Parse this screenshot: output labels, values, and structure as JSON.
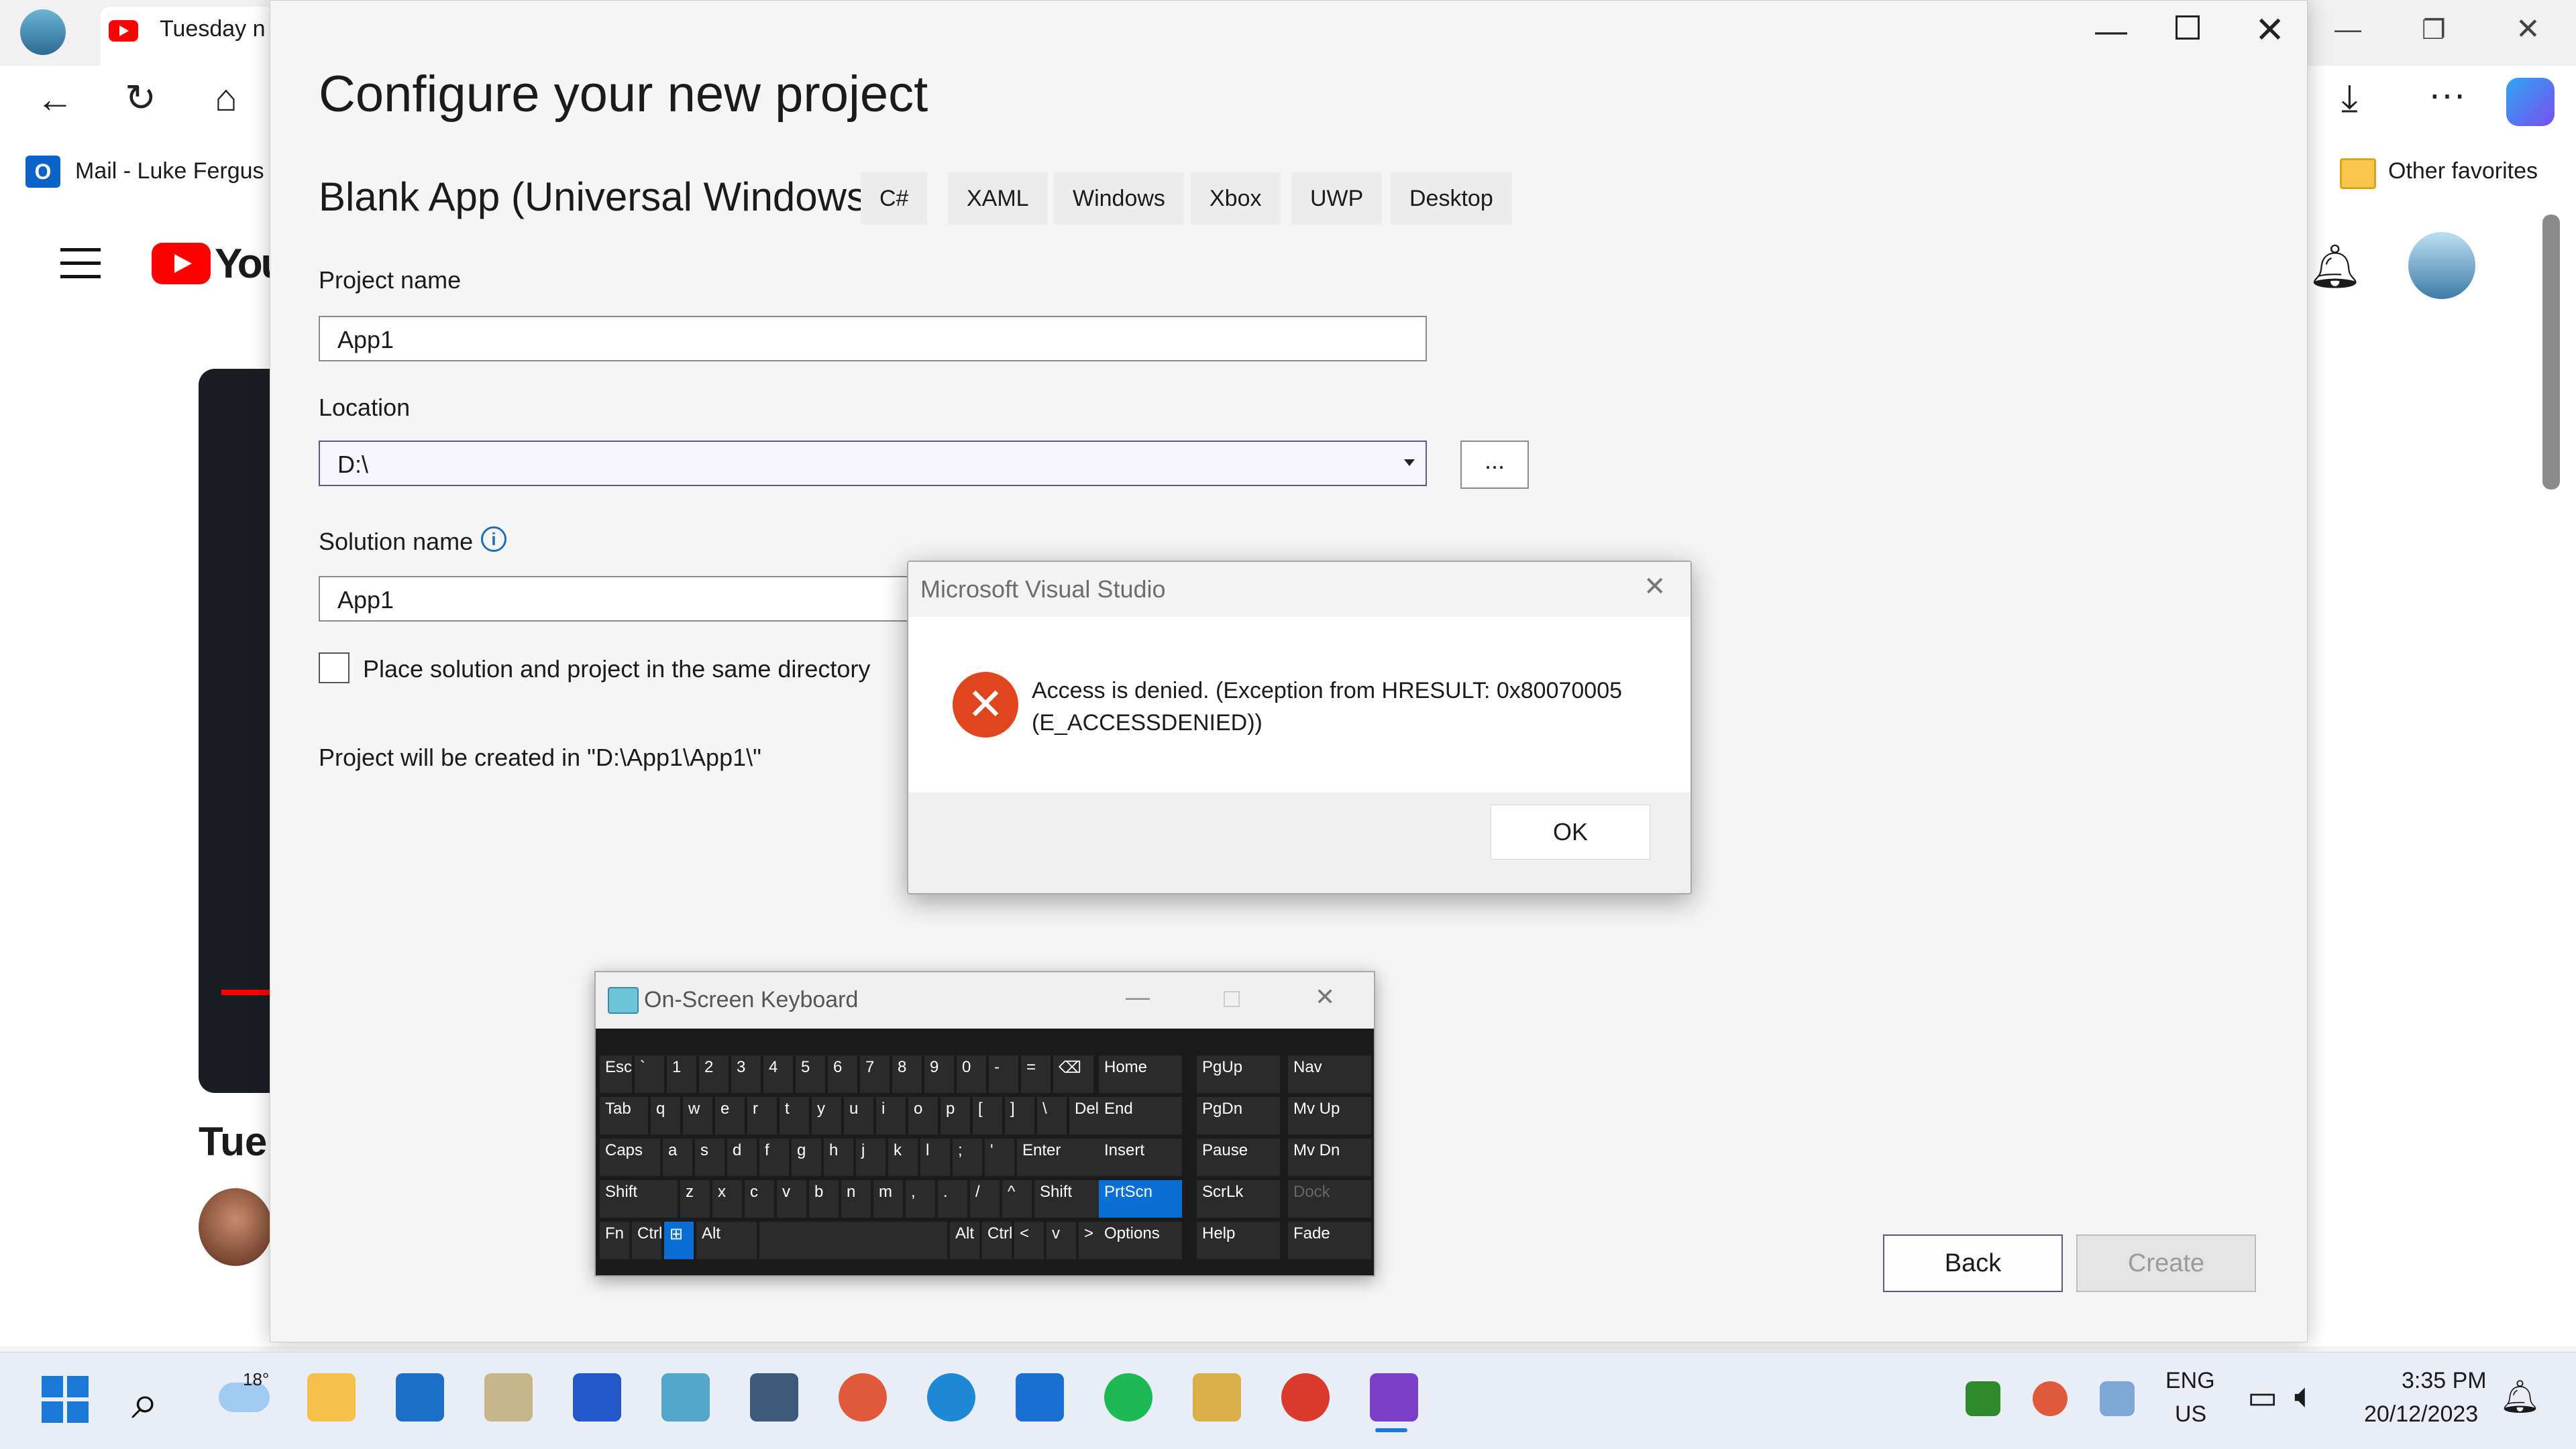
{
  "browser": {
    "tab_title": "Tuesday n",
    "favorites": {
      "mail": "Mail - Luke Fergus",
      "other": "Other favorites"
    }
  },
  "youtube": {
    "wordmark": "You",
    "title_fragment": "Tue"
  },
  "vs_dialog": {
    "title": "Configure your new project",
    "template_name": "Blank App (Universal Windows)",
    "tags": [
      "C#",
      "XAML",
      "Windows",
      "Xbox",
      "UWP",
      "Desktop"
    ],
    "project_name_label": "Project name",
    "project_name_value": "App1",
    "location_label": "Location",
    "location_value": "D:\\",
    "browse_label": "...",
    "solution_name_label": "Solution name",
    "solution_name_value": "App1",
    "same_dir_label": "Place solution and project in the same directory",
    "path_info": "Project will be created in \"D:\\App1\\App1\\\"",
    "back_label": "Back",
    "create_label": "Create"
  },
  "error_dialog": {
    "title": "Microsoft Visual Studio",
    "message": "Access is denied. (Exception from HRESULT: 0x80070005 (E_ACCESSDENIED))",
    "ok_label": "OK",
    "icon_color": "#e0461e"
  },
  "osk": {
    "title": "On-Screen Keyboard",
    "rows": [
      [
        "Esc",
        "`",
        "1",
        "2",
        "3",
        "4",
        "5",
        "6",
        "7",
        "8",
        "9",
        "0",
        "-",
        "=",
        "⌫"
      ],
      [
        "Tab",
        "q",
        "w",
        "e",
        "r",
        "t",
        "y",
        "u",
        "i",
        "o",
        "p",
        "[",
        "]",
        "\\",
        "Del"
      ],
      [
        "Caps",
        "a",
        "s",
        "d",
        "f",
        "g",
        "h",
        "j",
        "k",
        "l",
        ";",
        "'",
        "Enter"
      ],
      [
        "Shift",
        "z",
        "x",
        "c",
        "v",
        "b",
        "n",
        "m",
        ",",
        ".",
        "/",
        "^",
        "Shift"
      ],
      [
        "Fn",
        "Ctrl",
        "⊞",
        "Alt",
        "",
        "Alt",
        "Ctrl",
        "<",
        "v",
        ">",
        "▤"
      ]
    ],
    "nav_keys": [
      [
        "Home",
        "PgUp",
        "Nav"
      ],
      [
        "End",
        "PgDn",
        "Mv Up"
      ],
      [
        "Insert",
        "Pause",
        "Mv Dn"
      ],
      [
        "PrtScn",
        "ScrLk",
        "Dock"
      ],
      [
        "Options",
        "Help",
        "Fade"
      ]
    ]
  },
  "taskbar": {
    "weather_temp": "18°",
    "lang_line1": "ENG",
    "lang_line2": "US",
    "time": "3:35 PM",
    "date": "20/12/2023"
  }
}
